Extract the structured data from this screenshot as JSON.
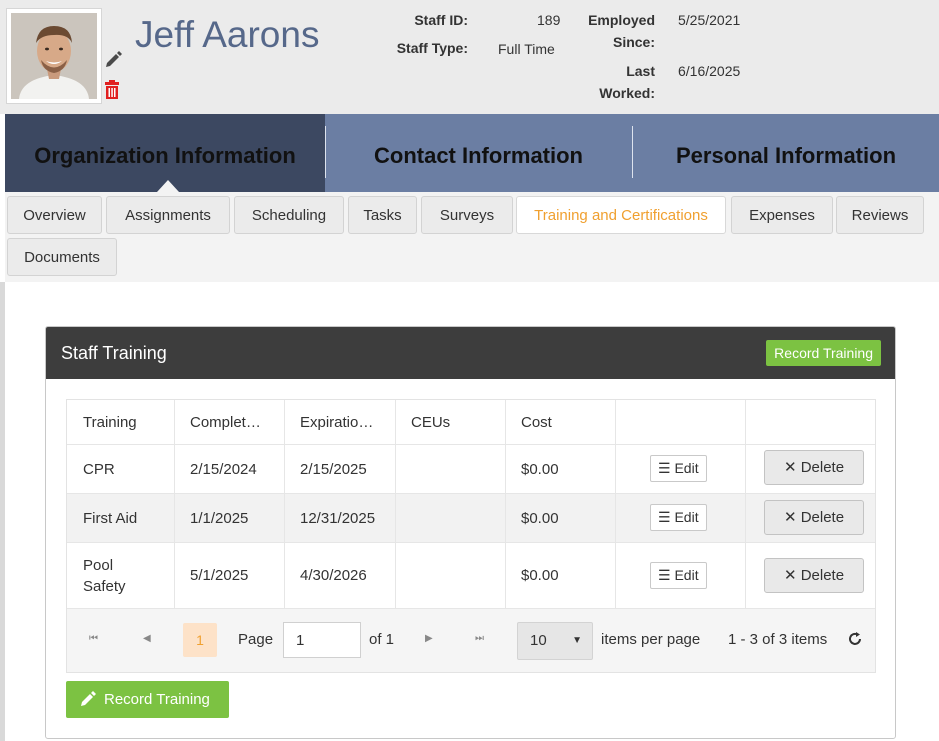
{
  "staff": {
    "name": "Jeff Aarons",
    "id_label": "Staff ID:",
    "id_value": "189",
    "type_label": "Staff Type:",
    "type_value": "Full Time",
    "employed_label_1": "Employed",
    "employed_label_2": "Since:",
    "employed_value": "5/25/2021",
    "last_label_1": "Last",
    "last_label_2": "Worked:",
    "last_value": "6/16/2025"
  },
  "sections": [
    "Organization Information",
    "Contact Information",
    "Personal Information"
  ],
  "subtabs": [
    "Overview",
    "Assignments",
    "Scheduling",
    "Tasks",
    "Surveys",
    "Training and Certifications",
    "Expenses",
    "Reviews",
    "Documents"
  ],
  "panel": {
    "title": "Staff Training",
    "record_button": "Record Training"
  },
  "grid": {
    "headers": [
      "Training",
      "Complet…",
      "Expiratio…",
      "CEUs",
      "Cost"
    ],
    "rows": [
      {
        "training": "CPR",
        "completed": "2/15/2024",
        "expiration": "2/15/2025",
        "ceus": "",
        "cost": "$0.00"
      },
      {
        "training": "First Aid",
        "completed": "1/1/2025",
        "expiration": "12/31/2025",
        "ceus": "",
        "cost": "$0.00"
      },
      {
        "training_line1": "Pool",
        "training_line2": "Safety",
        "completed": "5/1/2025",
        "expiration": "4/30/2026",
        "ceus": "",
        "cost": "$0.00"
      }
    ],
    "edit_label": "Edit",
    "delete_label": "Delete"
  },
  "pager": {
    "current_page": "1",
    "page_label": "Page",
    "page_input": "1",
    "of_label": "of 1",
    "page_size": "10",
    "items_per_page": "items per page",
    "summary": "1 - 3 of 3 items"
  },
  "colors": {
    "accent_orange": "#f0a030",
    "green": "#7cc242",
    "nav_blue": "#6b7ea3",
    "nav_active": "#3c4861",
    "delete_red": "#e02020"
  }
}
